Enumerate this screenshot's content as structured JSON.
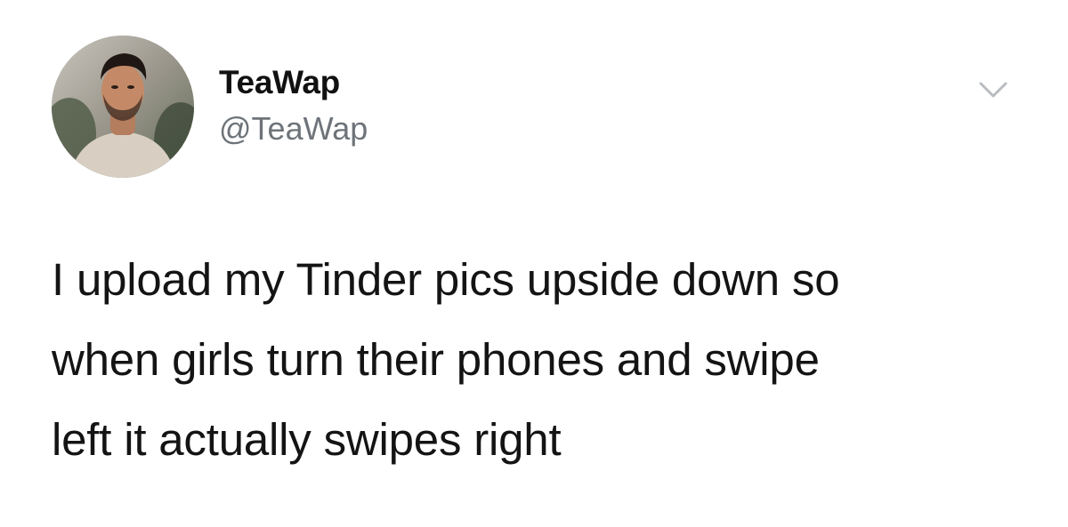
{
  "author": {
    "display_name": "TeaWap",
    "handle": "@TeaWap"
  },
  "tweet": {
    "lines": [
      "I upload my Tinder pics upside down so",
      "when girls turn their phones and swipe",
      "left it actually swipes right"
    ]
  },
  "icons": {
    "avatar": "profile-photo",
    "menu": "chevron-down-icon"
  },
  "colors": {
    "text": "#141414",
    "handle": "#6e7479",
    "caret": "#b8bcc0",
    "background": "#ffffff"
  }
}
